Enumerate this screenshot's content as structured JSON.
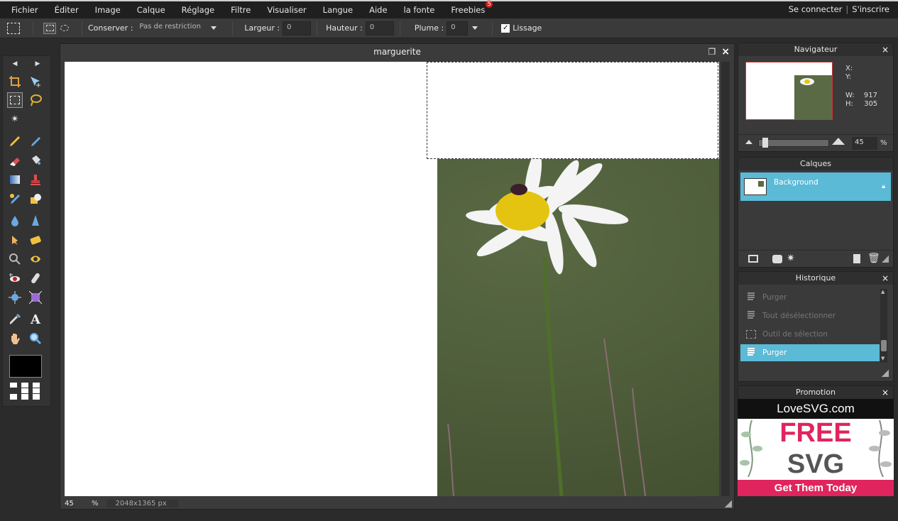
{
  "menu": {
    "items": [
      "Fichier",
      "Éditer",
      "Image",
      "Calque",
      "Réglage",
      "Filtre",
      "Visualiser",
      "Langue",
      "Aide",
      "la fonte",
      "Freebies"
    ],
    "freebies_badge": "5",
    "login": "Se connecter",
    "separator": "|",
    "signup": "S'inscrire"
  },
  "options": {
    "conserver_label": "Conserver :",
    "conserver_value": "Pas de restriction",
    "largeur_label": "Largeur :",
    "largeur_value": "0",
    "hauteur_label": "Hauteur :",
    "hauteur_value": "0",
    "plume_label": "Plume :",
    "plume_value": "0",
    "lissage_label": "Lissage",
    "lissage_checked": "✓"
  },
  "document": {
    "title": "marguerite",
    "zoom": "45",
    "zoom_unit": "%",
    "dimensions": "2048x1365 px"
  },
  "navigator": {
    "title": "Navigateur",
    "x_label": "X:",
    "y_label": "Y:",
    "w_label": "W:",
    "w_value": "917",
    "h_label": "H:",
    "h_value": "305",
    "zoom_value": "45",
    "zoom_unit": "%"
  },
  "layers": {
    "title": "Calques",
    "items": [
      {
        "name": "Background"
      }
    ]
  },
  "history": {
    "title": "Historique",
    "items": [
      {
        "label": "Purger"
      },
      {
        "label": "Tout désélectionner"
      },
      {
        "label": "Outil de sélection"
      },
      {
        "label": "Purger"
      }
    ]
  },
  "promotion": {
    "title": "Promotion",
    "brand": "LoveSVG.com",
    "line1": "FREE",
    "line2": "SVG",
    "cta": "Get Them Today"
  },
  "colors": {
    "accent": "#5bbad6",
    "promo_pink": "#e0245e",
    "foreground_color": "#000000"
  },
  "close_glyph": "×"
}
